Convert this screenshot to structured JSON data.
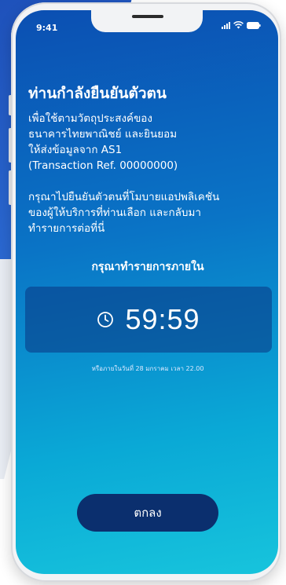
{
  "status_bar": {
    "time": "9:41"
  },
  "main": {
    "title": "ท่านกำลังยืนยันตัวตน",
    "paragraph1_lines": [
      "เพื่อใช้ตามวัตถุประสงค์ของ",
      "ธนาคารไทยพาณิชย์ และยินยอม",
      "ให้ส่งข้อมูลจาก AS1",
      "(Transaction Ref. 00000000)"
    ],
    "paragraph2_lines": [
      "กรุณาไปยืนยันตัวตนที่โมบายแอปพลิเคชัน",
      "ของผู้ให้บริการที่ท่านเลือก และกลับมา",
      "ทำรายการต่อที่นี่"
    ],
    "deadline_label": "กรุณาทำรายการภายใน",
    "timer": "59:59",
    "expiry_note": "หรือภายในวันที่ 28 มกราคม เวลา 22.00"
  },
  "actions": {
    "ok_label": "ตกลง"
  },
  "icons": {
    "clock": "clock-icon",
    "signal": "signal-icon",
    "wifi": "wifi-icon",
    "battery": "battery-icon"
  },
  "colors": {
    "screen_gradient_top": "#0b4fb2",
    "screen_gradient_bottom": "#17c4dc",
    "button": "#0b2f6e",
    "timer_box": "#0a3482"
  }
}
